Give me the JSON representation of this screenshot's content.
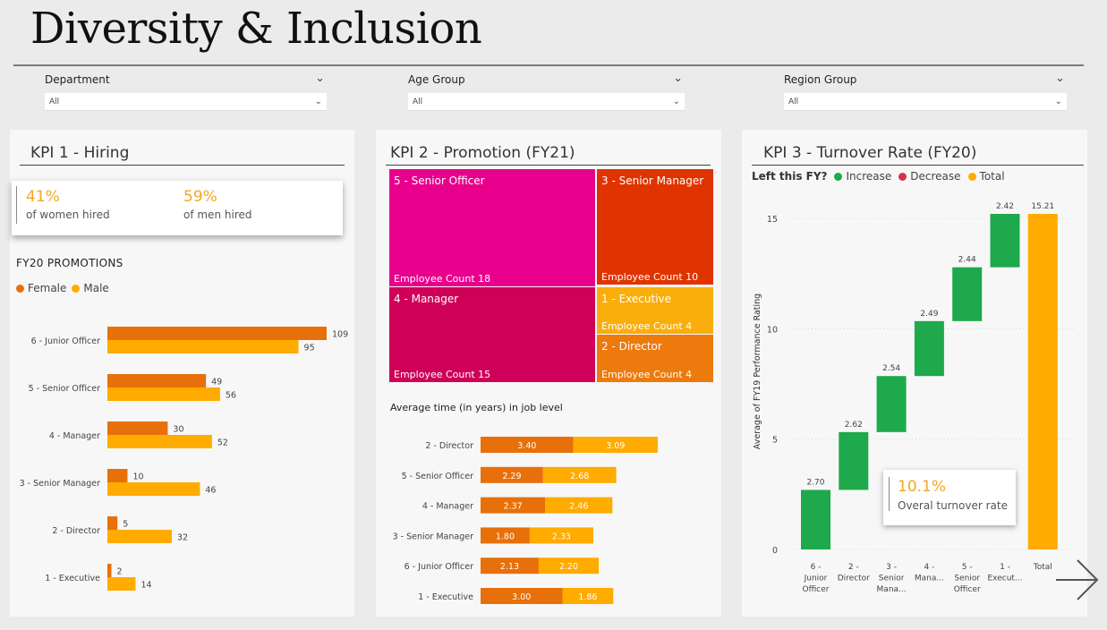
{
  "header": {
    "title": "Diversity & Inclusion"
  },
  "filters": [
    {
      "label": "Department",
      "value": "All"
    },
    {
      "label": "Age Group",
      "value": "All"
    },
    {
      "label": "Region Group",
      "value": "All"
    }
  ],
  "kpi1": {
    "title": "KPI 1 - Hiring",
    "women_pct": "41%",
    "women_label": "of women hired",
    "men_pct": "59%",
    "men_label": "of men hired",
    "section_title": "FY20 PROMOTIONS",
    "legend": {
      "female": "Female",
      "male": "Male"
    }
  },
  "kpi2": {
    "title": "KPI 2 - Promotion (FY21)",
    "treemap": [
      {
        "name": "5 - Senior Officer",
        "count_label": "Employee Count 18",
        "color": "#e8008c"
      },
      {
        "name": "3 - Senior Manager",
        "count_label": "Employee Count 10",
        "color": "#e03400"
      },
      {
        "name": "4 - Manager",
        "count_label": "Employee Count 15",
        "color": "#cf0058"
      },
      {
        "name": "1 - Executive",
        "count_label": "Employee Count 4",
        "color": "#f9ae0b"
      },
      {
        "name": "2 - Director",
        "count_label": "Employee Count 4",
        "color": "#ec7a0c"
      }
    ],
    "section_title": "Average time (in years) in job level"
  },
  "kpi3": {
    "title": "KPI 3 - Turnover Rate (FY20)",
    "legend": {
      "prefix": "Left this FY?",
      "increase": "Increase",
      "decrease": "Decrease",
      "total": "Total"
    },
    "turnover_value": "10.1%",
    "turnover_label": "Overal turnover rate"
  },
  "colors": {
    "female": "#e8700a",
    "male": "#ffab00",
    "increase": "#1ea94c",
    "decrease": "#d8334a",
    "total": "#ffab00"
  },
  "chart_data": [
    {
      "type": "bar",
      "orientation": "horizontal",
      "title": "FY20 PROMOTIONS",
      "categories": [
        "6 - Junior Officer",
        "5 - Senior Officer",
        "4 - Manager",
        "3 - Senior Manager",
        "2 - Director",
        "1 - Executive"
      ],
      "series": [
        {
          "name": "Female",
          "values": [
            109,
            49,
            30,
            10,
            5,
            2
          ]
        },
        {
          "name": "Male",
          "values": [
            95,
            56,
            52,
            46,
            32,
            14
          ]
        }
      ],
      "xlim": [
        0,
        109
      ]
    },
    {
      "type": "bar",
      "orientation": "horizontal",
      "stacked": true,
      "title": "Average time (in years) in job level",
      "categories": [
        "2 - Director",
        "5 - Senior Officer",
        "4 - Manager",
        "3 - Senior Manager",
        "6 - Junior Officer",
        "1 - Executive"
      ],
      "series": [
        {
          "values": [
            3.4,
            2.29,
            2.37,
            1.8,
            2.13,
            3.0
          ]
        },
        {
          "values": [
            3.09,
            2.68,
            2.46,
            2.33,
            2.2,
            1.86
          ]
        }
      ],
      "labels": [
        [
          "3.40",
          "3.09"
        ],
        [
          "2.29",
          "2.68"
        ],
        [
          "2.37",
          "2.46"
        ],
        [
          "1.80",
          "2.33"
        ],
        [
          "2.13",
          "2.20"
        ],
        [
          "3.00",
          "1.86"
        ]
      ]
    },
    {
      "type": "waterfall",
      "ylabel": "Average of FY19 Performance Rating",
      "categories": [
        [
          "6 -",
          "Junior",
          "Officer"
        ],
        [
          "2 -",
          "Director"
        ],
        [
          "3 -",
          "Senior",
          "Mana..."
        ],
        [
          "4 -",
          "Mana..."
        ],
        [
          "5 -",
          "Senior",
          "Officer"
        ],
        [
          "1 -",
          "Execut..."
        ],
        [
          "Total"
        ]
      ],
      "values": [
        2.7,
        2.62,
        2.54,
        2.49,
        2.44,
        2.42,
        15.21
      ],
      "value_labels": [
        "2.70",
        "2.62",
        "2.54",
        "2.49",
        "2.44",
        "2.42",
        "15.21"
      ],
      "kinds": [
        "increase",
        "increase",
        "increase",
        "increase",
        "increase",
        "increase",
        "total"
      ],
      "ylim": [
        0,
        15.21
      ],
      "yticks": [
        0,
        5,
        10,
        15
      ]
    }
  ]
}
